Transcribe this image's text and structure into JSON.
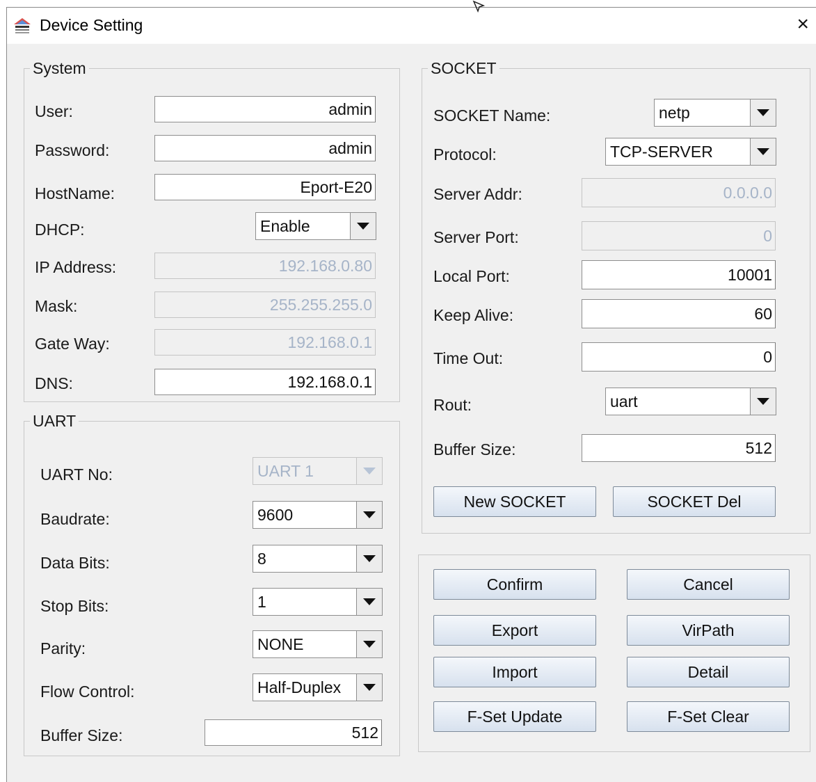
{
  "window": {
    "title": "Device Setting",
    "close_glyph": "×"
  },
  "system": {
    "legend": "System",
    "user_label": "User:",
    "user_value": "admin",
    "password_label": "Password:",
    "password_value": "admin",
    "hostname_label": "HostName:",
    "hostname_value": "Eport-E20",
    "dhcp_label": "DHCP:",
    "dhcp_value": "Enable",
    "ip_label": "IP Address:",
    "ip_value": "192.168.0.80",
    "mask_label": "Mask:",
    "mask_value": "255.255.255.0",
    "gateway_label": "Gate Way:",
    "gateway_value": "192.168.0.1",
    "dns_label": "DNS:",
    "dns_value": "192.168.0.1"
  },
  "uart": {
    "legend": "UART",
    "uart_no_label": "UART No:",
    "uart_no_value": "UART 1",
    "baudrate_label": "Baudrate:",
    "baudrate_value": "9600",
    "databits_label": "Data Bits:",
    "databits_value": "8",
    "stopbits_label": "Stop Bits:",
    "stopbits_value": "1",
    "parity_label": "Parity:",
    "parity_value": "NONE",
    "flow_label": "Flow Control:",
    "flow_value": "Half-Duplex",
    "buffer_label": "Buffer Size:",
    "buffer_value": "512"
  },
  "socket": {
    "legend": "SOCKET",
    "name_label": "SOCKET Name:",
    "name_value": "netp",
    "protocol_label": "Protocol:",
    "protocol_value": "TCP-SERVER",
    "server_addr_label": "Server Addr:",
    "server_addr_value": "0.0.0.0",
    "server_port_label": "Server Port:",
    "server_port_value": "0",
    "local_port_label": "Local Port:",
    "local_port_value": "10001",
    "keep_alive_label": "Keep Alive:",
    "keep_alive_value": "60",
    "timeout_label": "Time Out:",
    "timeout_value": "0",
    "rout_label": "Rout:",
    "rout_value": "uart",
    "buffer_label": "Buffer Size:",
    "buffer_value": "512",
    "new_button": "New SOCKET",
    "del_button": "SOCKET Del"
  },
  "actions": {
    "confirm": "Confirm",
    "cancel": "Cancel",
    "export": "Export",
    "virpath": "VirPath",
    "import": "Import",
    "detail": "Detail",
    "fset_update": "F-Set Update",
    "fset_clear": "F-Set Clear"
  },
  "icons": {
    "app": "app-logo-icon",
    "close": "close-icon",
    "dropdown": "chevron-down-icon",
    "cursor": "mouse-cursor-icon"
  },
  "colors": {
    "window_bg": "#f0f0f0",
    "disabled_text": "#a6b4c8",
    "button_top": "#f4f7fb",
    "button_bottom": "#d7e1ee"
  }
}
